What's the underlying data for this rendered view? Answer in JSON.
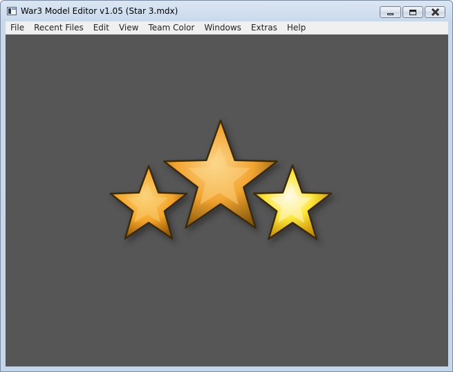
{
  "window": {
    "title": "War3 Model Editor v1.05 (Star 3.mdx)"
  },
  "menu": {
    "items": [
      "File",
      "Recent Files",
      "Edit",
      "View",
      "Team Color",
      "Windows",
      "Extras",
      "Help"
    ]
  },
  "viewport": {
    "background": "#565656",
    "stars": [
      {
        "name": "left-star",
        "fill": "#f4a52a",
        "highlight": "#fbd37a",
        "shadow": "#9a5c08"
      },
      {
        "name": "center-star",
        "fill": "#f2a431",
        "highlight": "#fcd68b",
        "shadow": "#8a5a0c"
      },
      {
        "name": "right-star",
        "fill": "#fde63b",
        "highlight": "#fffbe6",
        "shadow": "#c58a00"
      }
    ]
  }
}
